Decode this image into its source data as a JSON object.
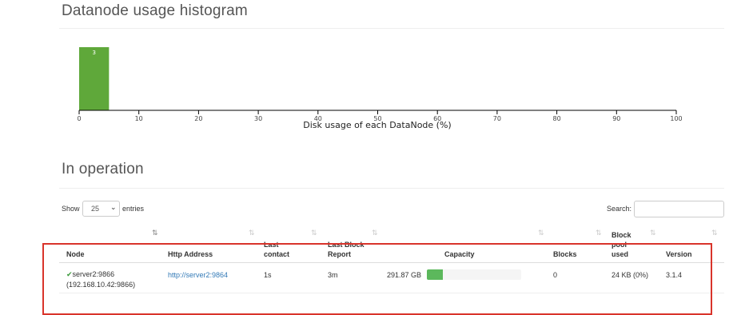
{
  "histogram": {
    "heading": "Datanode usage histogram",
    "chart_data": {
      "type": "bar",
      "title": "",
      "xlabel": "Disk usage of each DataNode (%)",
      "ylabel": "",
      "xlim": [
        0,
        100
      ],
      "xticks": [
        0,
        10,
        20,
        30,
        40,
        50,
        60,
        70,
        80,
        90,
        100
      ],
      "bins": [
        {
          "x0": 0,
          "x1": 5,
          "count": 3
        }
      ],
      "bar_color": "#5fa83a"
    }
  },
  "operation": {
    "heading": "In operation",
    "show_label": "Show",
    "entries_value": "25",
    "entries_label": "entries",
    "search_label": "Search:",
    "search_value": ""
  },
  "table": {
    "columns": {
      "node": "Node",
      "http": "Http Address",
      "last_contact_1": "Last",
      "last_contact_2": "contact",
      "last_block_1": "Last Block",
      "last_block_2": "Report",
      "capacity": "Capacity",
      "blocks": "Blocks",
      "pool_1": "Block",
      "pool_2": "pool",
      "pool_3": "used",
      "version": "Version"
    },
    "rows": [
      {
        "node": "server2:9866",
        "ip": "(192.168.10.42:9866)",
        "http": "http://server2:9864",
        "last_contact": "1s",
        "last_block_report": "3m",
        "capacity": "291.87 GB",
        "used_fraction": 0.17,
        "blocks": "0",
        "pool_used": "24 KB (0%)",
        "version": "3.1.4"
      }
    ]
  },
  "colors": {
    "accent_link": "#337ab7",
    "progress_fill": "#5cb85c",
    "highlight_frame": "#d9342b"
  }
}
